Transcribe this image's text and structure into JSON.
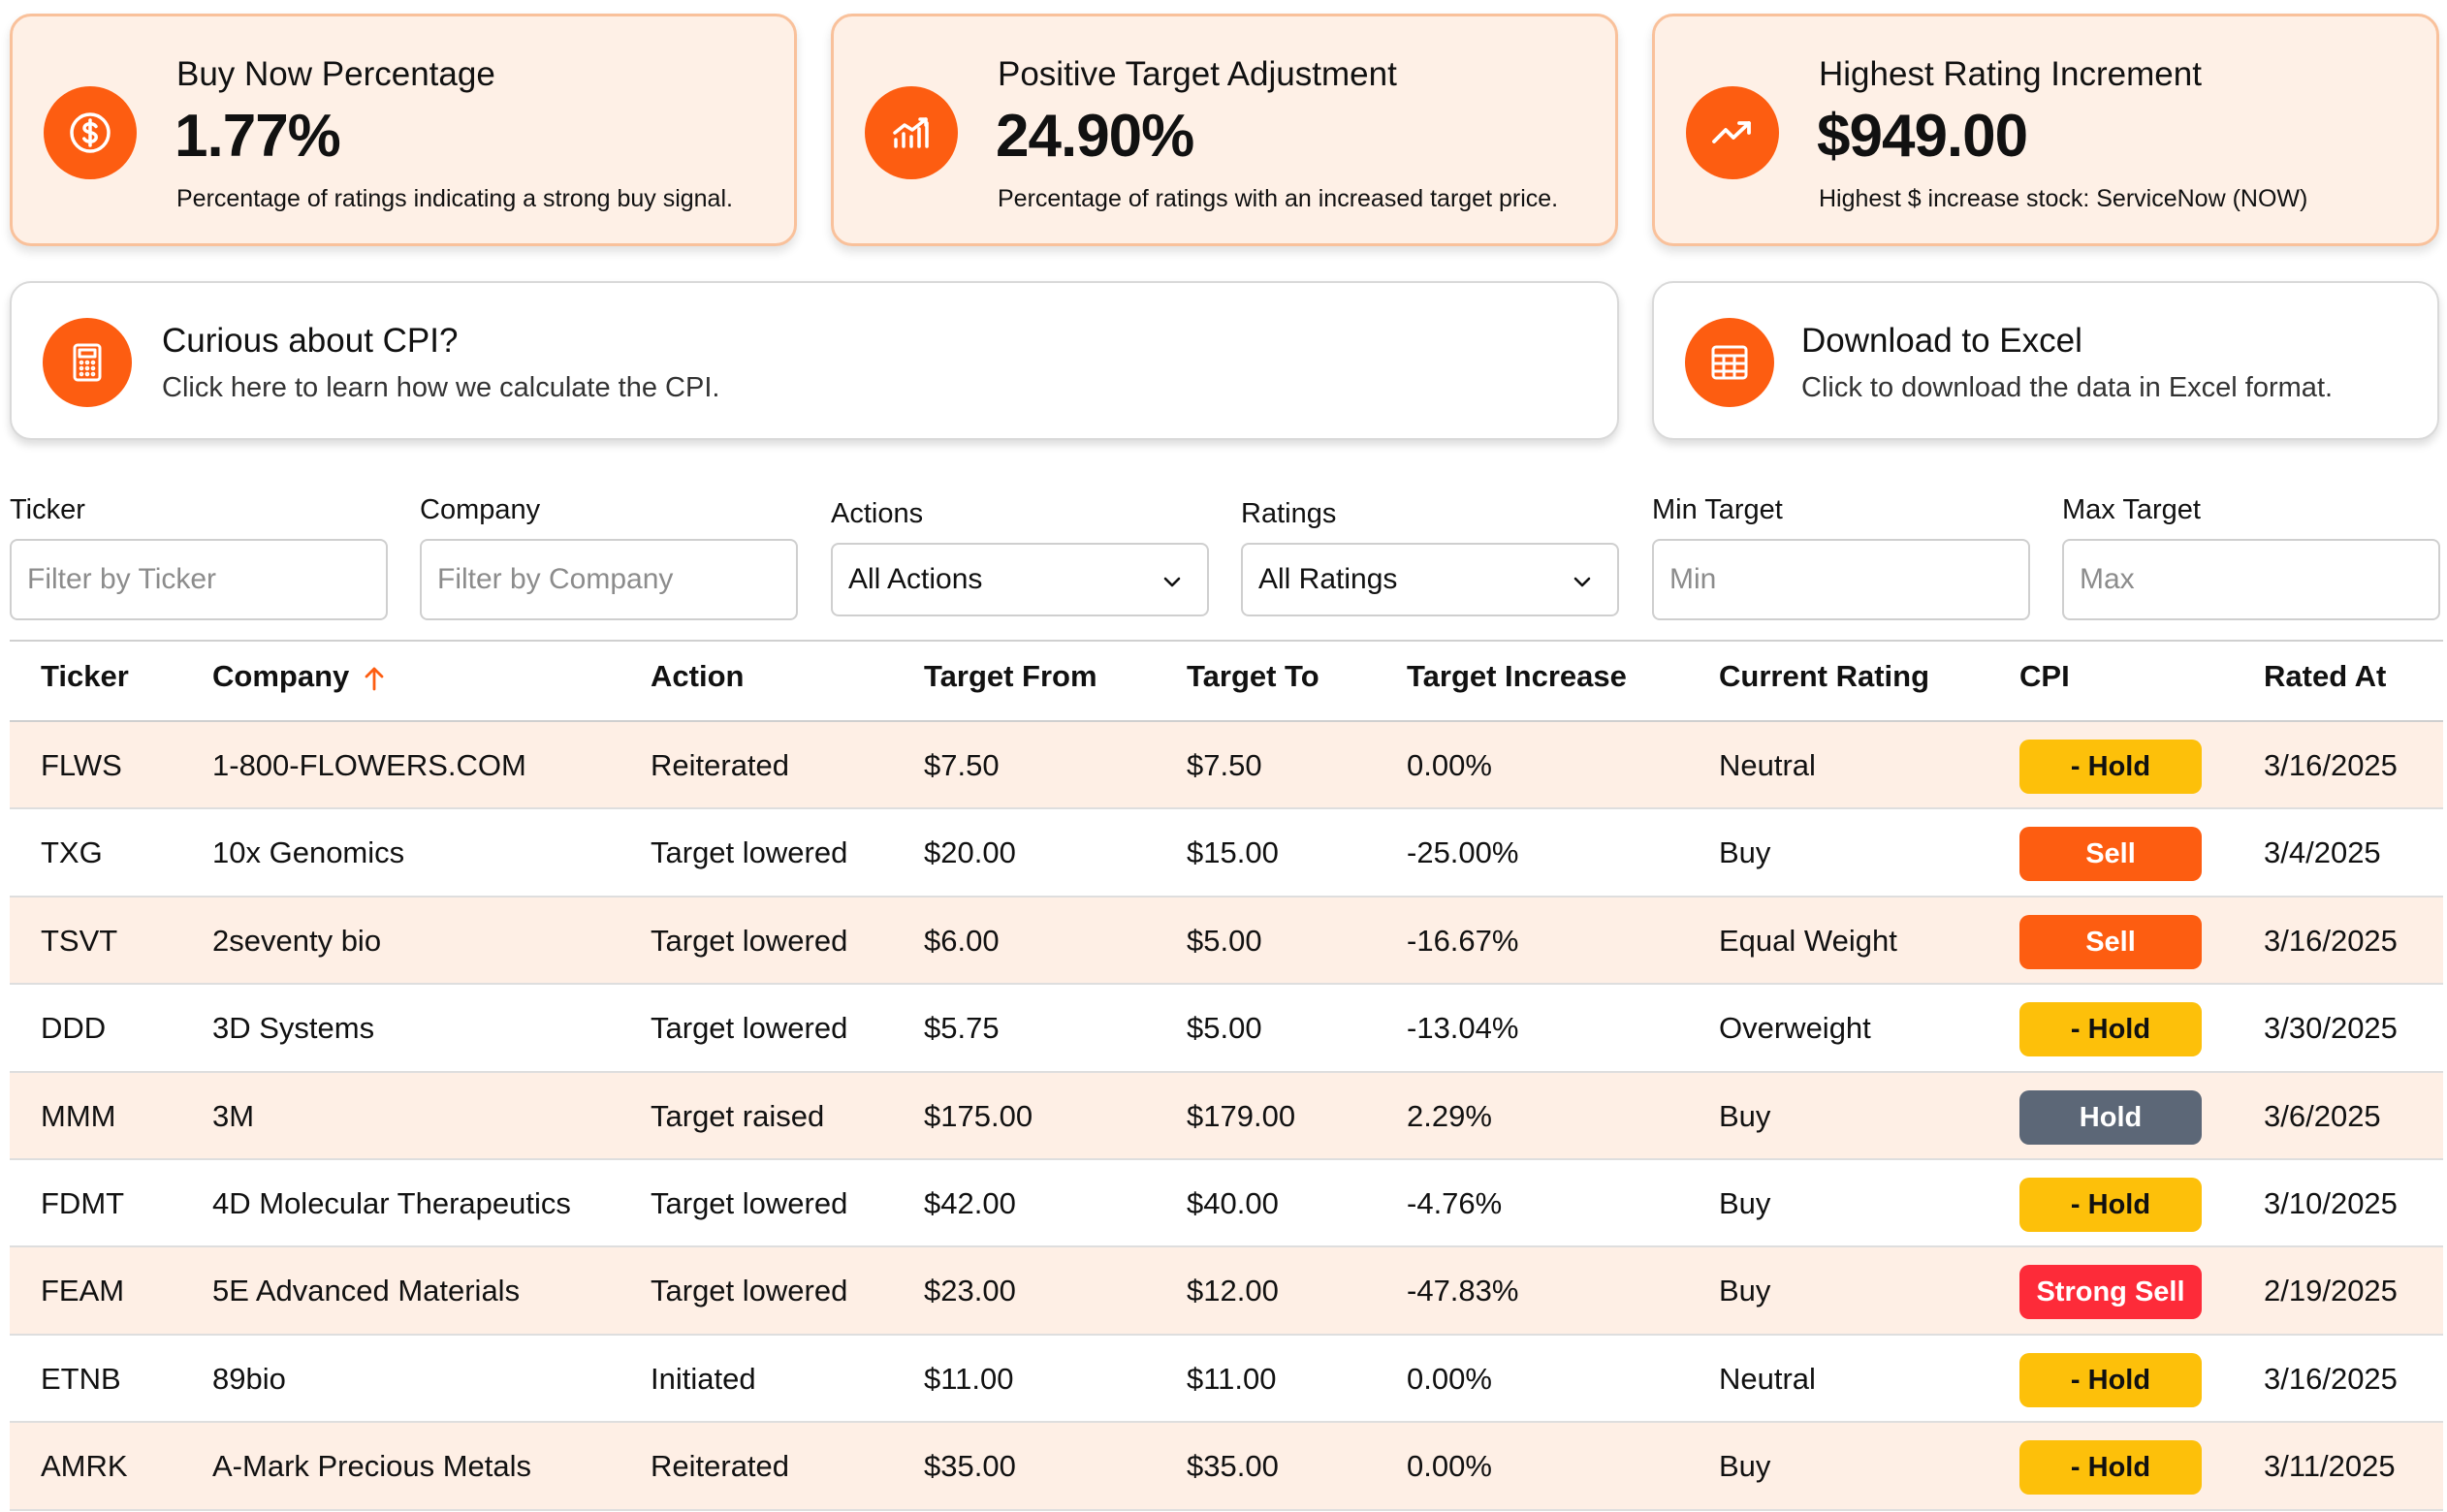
{
  "colors": {
    "accent": "#fd5d11",
    "card_bg": "#fef0e6",
    "card_border": "#f9c19b",
    "row_alt_bg": "#feefe5",
    "badge_hold_minus": "#fdc00a",
    "badge_sell": "#fd5d11",
    "badge_hold": "#5c6777",
    "badge_strong_sell": "#fd2b39"
  },
  "stats": [
    {
      "icon": "dollar-circle-icon",
      "title": "Buy Now Percentage",
      "value": "1.77%",
      "description": "Percentage of ratings indicating a strong buy signal."
    },
    {
      "icon": "bar-chart-icon",
      "title": "Positive Target Adjustment",
      "value": "24.90%",
      "description": "Percentage of ratings with an increased target price."
    },
    {
      "icon": "trending-up-icon",
      "title": "Highest Rating Increment",
      "value": "$949.00",
      "description": "Highest $ increase stock: ServiceNow (NOW)"
    }
  ],
  "cpi_card": {
    "icon": "calculator-icon",
    "title": "Curious about CPI?",
    "description": "Click here to learn how we calculate the CPI."
  },
  "excel_card": {
    "icon": "spreadsheet-icon",
    "title": "Download to Excel",
    "description": "Click to download the data in Excel format."
  },
  "filters": {
    "ticker": {
      "label": "Ticker",
      "placeholder": "Filter by Ticker",
      "value": ""
    },
    "company": {
      "label": "Company",
      "placeholder": "Filter by Company",
      "value": ""
    },
    "actions": {
      "label": "Actions",
      "selected": "All Actions"
    },
    "ratings": {
      "label": "Ratings",
      "selected": "All Ratings"
    },
    "min_target": {
      "label": "Min Target",
      "placeholder": "Min",
      "value": ""
    },
    "max_target": {
      "label": "Max Target",
      "placeholder": "Max",
      "value": ""
    }
  },
  "table": {
    "columns": [
      "Ticker",
      "Company",
      "Action",
      "Target From",
      "Target To",
      "Target Increase",
      "Current Rating",
      "CPI",
      "Rated At"
    ],
    "sort": {
      "column": "Company",
      "direction": "ascending",
      "icon": "arrow-up-icon"
    },
    "rows": [
      {
        "ticker": "FLWS",
        "company": "1-800-FLOWERS.COM",
        "action": "Reiterated",
        "target_from": "$7.50",
        "target_to": "$7.50",
        "target_increase": "0.00%",
        "current_rating": "Neutral",
        "cpi": "- Hold",
        "cpi_kind": "hold-minus",
        "rated_at": "3/16/2025"
      },
      {
        "ticker": "TXG",
        "company": "10x Genomics",
        "action": "Target lowered",
        "target_from": "$20.00",
        "target_to": "$15.00",
        "target_increase": "-25.00%",
        "current_rating": "Buy",
        "cpi": "Sell",
        "cpi_kind": "sell",
        "rated_at": "3/4/2025"
      },
      {
        "ticker": "TSVT",
        "company": "2seventy bio",
        "action": "Target lowered",
        "target_from": "$6.00",
        "target_to": "$5.00",
        "target_increase": "-16.67%",
        "current_rating": "Equal Weight",
        "cpi": "Sell",
        "cpi_kind": "sell",
        "rated_at": "3/16/2025"
      },
      {
        "ticker": "DDD",
        "company": "3D Systems",
        "action": "Target lowered",
        "target_from": "$5.75",
        "target_to": "$5.00",
        "target_increase": "-13.04%",
        "current_rating": "Overweight",
        "cpi": "- Hold",
        "cpi_kind": "hold-minus",
        "rated_at": "3/30/2025"
      },
      {
        "ticker": "MMM",
        "company": "3M",
        "action": "Target raised",
        "target_from": "$175.00",
        "target_to": "$179.00",
        "target_increase": "2.29%",
        "current_rating": "Buy",
        "cpi": "Hold",
        "cpi_kind": "hold",
        "rated_at": "3/6/2025"
      },
      {
        "ticker": "FDMT",
        "company": "4D Molecular Therapeutics",
        "action": "Target lowered",
        "target_from": "$42.00",
        "target_to": "$40.00",
        "target_increase": "-4.76%",
        "current_rating": "Buy",
        "cpi": "- Hold",
        "cpi_kind": "hold-minus",
        "rated_at": "3/10/2025"
      },
      {
        "ticker": "FEAM",
        "company": "5E Advanced Materials",
        "action": "Target lowered",
        "target_from": "$23.00",
        "target_to": "$12.00",
        "target_increase": "-47.83%",
        "current_rating": "Buy",
        "cpi": "Strong Sell",
        "cpi_kind": "strong-sell",
        "rated_at": "2/19/2025"
      },
      {
        "ticker": "ETNB",
        "company": "89bio",
        "action": "Initiated",
        "target_from": "$11.00",
        "target_to": "$11.00",
        "target_increase": "0.00%",
        "current_rating": "Neutral",
        "cpi": "- Hold",
        "cpi_kind": "hold-minus",
        "rated_at": "3/16/2025"
      },
      {
        "ticker": "AMRK",
        "company": "A-Mark Precious Metals",
        "action": "Reiterated",
        "target_from": "$35.00",
        "target_to": "$35.00",
        "target_increase": "0.00%",
        "current_rating": "Buy",
        "cpi": "- Hold",
        "cpi_kind": "hold-minus",
        "rated_at": "3/11/2025"
      }
    ]
  }
}
